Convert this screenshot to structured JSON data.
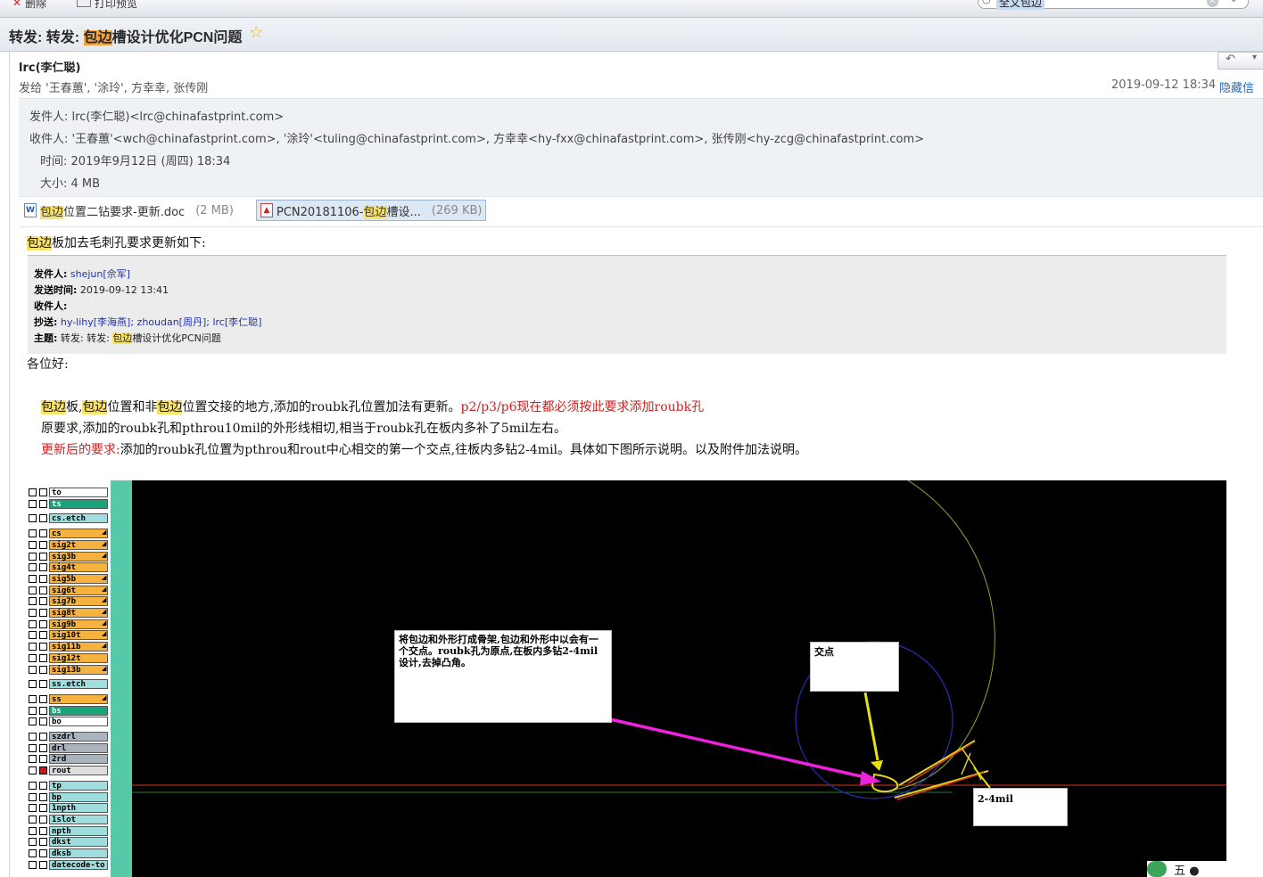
{
  "toolbar": {
    "delete_label": "删除",
    "print_label": "打印预览"
  },
  "search": {
    "query": "全文包边"
  },
  "message": {
    "subject_prefix": "转发: 转发: ",
    "subject_hl": "包边",
    "subject_rest": "槽设计优化PCN问题",
    "from_name": "lrc(李仁聪)",
    "to_line": "发给 '王春蕙', '涂玲', 方幸幸, 张传刚",
    "date": "2019-09-12 18:34",
    "hide_details": "隐藏信息",
    "sender_label": "发件人:",
    "sender": "lrc(李仁聪)<lrc@chinafastprint.com>",
    "recipients_label": "收件人:",
    "recipients": "'王春蕙'<wch@chinafastprint.com>, '涂玲'<tuling@chinafastprint.com>, 方幸幸<hy-fxx@chinafastprint.com>, 张传刚<hy-zcg@chinafastprint.com>",
    "time_label": "时间:",
    "time": "2019年9月12日 (周四) 18:34",
    "size_label": "大小:",
    "size": "4 MB"
  },
  "attachments": [
    {
      "hl": "包边",
      "name": "位置二钻要求-更新.doc",
      "size": "(2 MB)"
    },
    {
      "prefix": "PCN20181106-",
      "hl": "包边",
      "name": "槽设...",
      "size": "(269 KB)"
    }
  ],
  "body": {
    "intro_hl": "包边",
    "intro": "板加去毛刺孔要求更新如下:",
    "fwd_from_label": "发件人:",
    "fwd_from": "shejun[佘军]",
    "fwd_time_label": "发送时间:",
    "fwd_time": "2019-09-12 13:41",
    "fwd_to_label": "收件人:",
    "fwd_cc_label": "抄送:",
    "fwd_cc": "hy-lihy[李海燕]; zhoudan[周丹]; lrc[李仁聪]",
    "fwd_subj_label": "主题:",
    "fwd_subj_a": "转发: 转发: ",
    "fwd_subj_hl": "包边",
    "fwd_subj_b": "槽设计优化PCN问题",
    "greeting": "各位好:",
    "p1_a": "包边",
    "p1_b": "板,",
    "p1_c": "包边",
    "p1_d": "位置和非",
    "p1_e": "包边",
    "p1_f": "位置交接的地方,添加的roubk孔位置加法有更新。",
    "p1_red": "p2/p3/p6现在都必须按此要求添加roubk孔",
    "p2": "原要求,添加的roubk孔和pthrou10mil的外形线相切,相当于roubk孔在板内多补了5mil左右。",
    "p3_red": "更新后的要求:",
    "p3": "添加的roubk孔位置为pthrou和rout中心相交的第一个交点,往板内多钻2-4mil。具体如下图所示说明。以及附件加法说明。"
  },
  "image": {
    "layers": [
      {
        "name": "to",
        "color": "#ffffff"
      },
      {
        "name": "ts",
        "color": "#1aa37a"
      },
      {
        "name": "cs.etch",
        "color": "#9fdede",
        "gap": 1
      },
      {
        "name": "cs",
        "color": "#f5b23e",
        "gap": 1,
        "mark": true
      },
      {
        "name": "sig2t",
        "color": "#f5b23e",
        "mark": true
      },
      {
        "name": "sig3b",
        "color": "#f5b23e",
        "mark": true
      },
      {
        "name": "sig4t",
        "color": "#f5b23e"
      },
      {
        "name": "sig5b",
        "color": "#f5b23e",
        "mark": true
      },
      {
        "name": "sig6t",
        "color": "#f5b23e",
        "mark": true
      },
      {
        "name": "sig7b",
        "color": "#f5b23e",
        "mark": true
      },
      {
        "name": "sig8t",
        "color": "#f5b23e",
        "mark": true
      },
      {
        "name": "sig9b",
        "color": "#f5b23e",
        "mark": true
      },
      {
        "name": "sig10t",
        "color": "#f5b23e",
        "mark": true
      },
      {
        "name": "sig11b",
        "color": "#f5b23e",
        "mark": true
      },
      {
        "name": "sig12t",
        "color": "#f5b23e"
      },
      {
        "name": "sig13b",
        "color": "#f5b23e",
        "mark": true
      },
      {
        "name": "ss.etch",
        "color": "#9fdede",
        "gap": 1
      },
      {
        "name": "ss",
        "color": "#f5b23e",
        "gap": 1,
        "mark": true
      },
      {
        "name": "bs",
        "color": "#1aa37a"
      },
      {
        "name": "bo",
        "color": "#ffffff"
      },
      {
        "name": "szdrl",
        "color": "#a9b4bd",
        "gap": 1
      },
      {
        "name": "drl",
        "color": "#a9b4bd"
      },
      {
        "name": "2rd",
        "color": "#a9b4bd"
      },
      {
        "name": "rout",
        "color": "#dddddd",
        "red": true
      },
      {
        "name": "tp",
        "color": "#9fdede",
        "gap": 1
      },
      {
        "name": "bp",
        "color": "#9fdede"
      },
      {
        "name": "1npth",
        "color": "#9fdede"
      },
      {
        "name": "1slot",
        "color": "#9fdede"
      },
      {
        "name": "npth",
        "color": "#9fdede"
      },
      {
        "name": "dkst",
        "color": "#9fdede"
      },
      {
        "name": "dksb",
        "color": "#9fdede"
      },
      {
        "name": "datecode-to",
        "color": "#9fdede"
      }
    ],
    "note1": "将包边和外形打成骨架,包边和外形中以会有一个交点。roubk孔为原点,在板内多钻2-4mil设计,去掉凸角。",
    "note2": "交点",
    "note3": "2-4mil"
  },
  "tray": {
    "label": "五"
  }
}
